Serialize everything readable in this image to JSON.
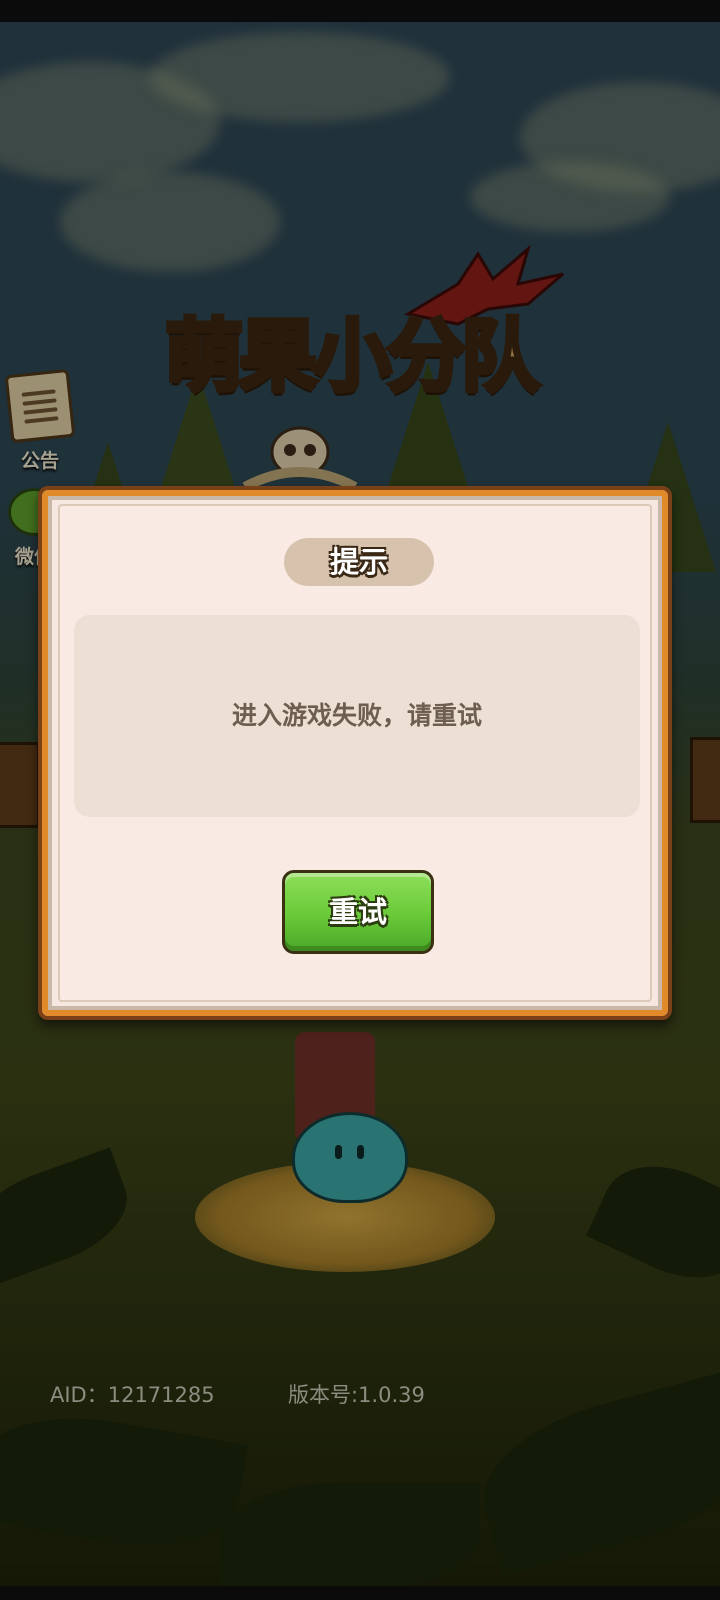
{
  "game": {
    "logo_title": "萌果小分队"
  },
  "side_buttons": {
    "notice_label": "公告",
    "wechat_label": "微信"
  },
  "dialog": {
    "title": "提示",
    "message": "进入游戏失败，请重试",
    "retry_label": "重试"
  },
  "footer": {
    "aid": "AID：12171285",
    "version": "版本号:1.0.39"
  },
  "icons": {
    "notice": "notice-board-icon",
    "wechat": "wechat-chat-icon"
  },
  "colors": {
    "retry_button": "#6ccc3a",
    "dialog_border": "#e08a2a",
    "dialog_bg": "#f6e8e0",
    "title_pill": "#d7c3ad"
  }
}
